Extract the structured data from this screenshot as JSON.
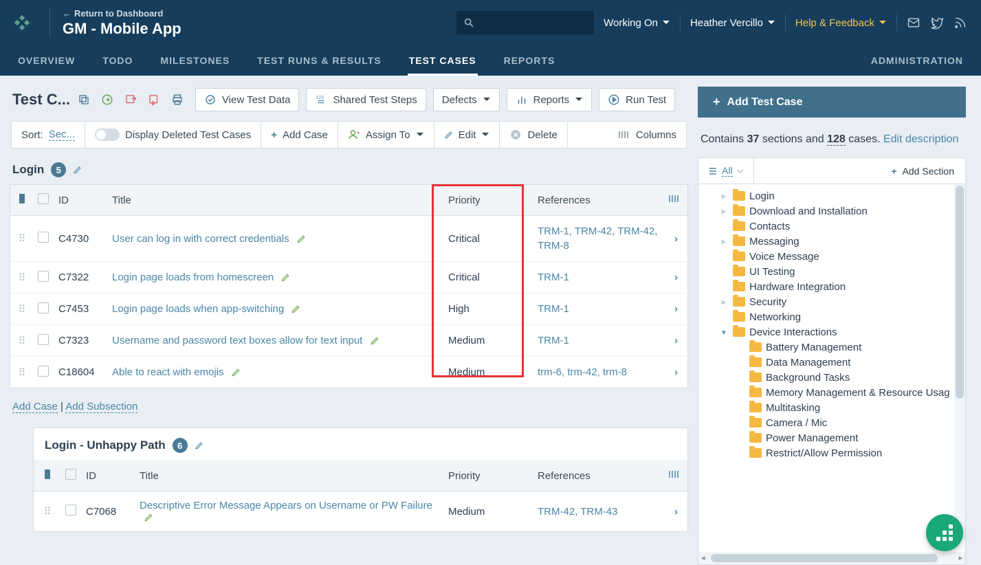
{
  "topbar": {
    "return_link": "Return to Dashboard",
    "app_title": "GM - Mobile App",
    "working_on": "Working On",
    "user": "Heather Vercillo",
    "help": "Help & Feedback"
  },
  "nav": {
    "overview": "OVERVIEW",
    "todo": "TODO",
    "milestones": "MILESTONES",
    "runs": "TEST RUNS & RESULTS",
    "cases": "TEST CASES",
    "reports": "REPORTS",
    "admin": "ADMINISTRATION"
  },
  "toolbar": {
    "page_title": "Test C...",
    "view_test_data": "View Test Data",
    "shared_steps": "Shared Test Steps",
    "defects": "Defects",
    "reports": "Reports",
    "run_test": "Run Test"
  },
  "toolbar2": {
    "sort_label": "Sort:",
    "sort_value": "Sec...",
    "display_deleted": "Display Deleted Test Cases",
    "add_case": "Add Case",
    "assign_to": "Assign To",
    "edit": "Edit",
    "delete": "Delete",
    "columns": "Columns"
  },
  "section": {
    "title": "Login",
    "count": "5"
  },
  "columns": {
    "id": "ID",
    "title": "Title",
    "priority": "Priority",
    "references": "References"
  },
  "rows": [
    {
      "id": "C4730",
      "title": "User can log in with correct credentials",
      "priority": "Critical",
      "refs": "TRM-1, TRM-42, TRM-42, TRM-8"
    },
    {
      "id": "C7322",
      "title": "Login page loads from homescreen",
      "priority": "Critical",
      "refs": "TRM-1"
    },
    {
      "id": "C7453",
      "title": "Login page loads when app-switching",
      "priority": "High",
      "refs": "TRM-1"
    },
    {
      "id": "C7323",
      "title": "Username and password text boxes allow for text input",
      "priority": "Medium",
      "refs": "TRM-1"
    },
    {
      "id": "C18604",
      "title": "Able to react with emojis",
      "priority": "Medium",
      "refs": "trm-6, trm-42, trm-8"
    }
  ],
  "footer_links": {
    "add_case": "Add Case",
    "add_subsection": "Add Subsection"
  },
  "subsection": {
    "title": "Login - Unhappy Path",
    "count": "6",
    "rows": [
      {
        "id": "C7068",
        "title": "Descriptive Error Message Appears on Username or PW Failure",
        "priority": "Medium",
        "refs": "TRM-42, TRM-43"
      }
    ]
  },
  "side": {
    "add_tc": "Add Test Case",
    "contains_pre": "Contains ",
    "sections_num": "37",
    "sections_word": " sections and ",
    "cases_num": "128",
    "cases_word": " cases",
    "edit_desc": "Edit description",
    "all": "All",
    "add_section": "Add Section",
    "tree": [
      {
        "label": "Login",
        "depth": 1,
        "toggle": "▹"
      },
      {
        "label": "Download and Installation",
        "depth": 1,
        "toggle": "▹"
      },
      {
        "label": "Contacts",
        "depth": 1,
        "toggle": ""
      },
      {
        "label": "Messaging",
        "depth": 1,
        "toggle": "▹"
      },
      {
        "label": "Voice Message",
        "depth": 1,
        "toggle": ""
      },
      {
        "label": "UI Testing",
        "depth": 1,
        "toggle": ""
      },
      {
        "label": "Hardware Integration",
        "depth": 1,
        "toggle": ""
      },
      {
        "label": "Security",
        "depth": 1,
        "toggle": "▹"
      },
      {
        "label": "Networking",
        "depth": 1,
        "toggle": ""
      },
      {
        "label": "Device Interactions",
        "depth": 1,
        "toggle": "▾"
      },
      {
        "label": "Battery Management",
        "depth": 2,
        "toggle": ""
      },
      {
        "label": "Data Management",
        "depth": 2,
        "toggle": ""
      },
      {
        "label": "Background Tasks",
        "depth": 2,
        "toggle": ""
      },
      {
        "label": "Memory Management & Resource Usag",
        "depth": 2,
        "toggle": ""
      },
      {
        "label": "Multitasking",
        "depth": 2,
        "toggle": ""
      },
      {
        "label": "Camera / Mic",
        "depth": 2,
        "toggle": ""
      },
      {
        "label": "Power Management",
        "depth": 2,
        "toggle": ""
      },
      {
        "label": "Restrict/Allow Permission",
        "depth": 2,
        "toggle": ""
      }
    ]
  }
}
